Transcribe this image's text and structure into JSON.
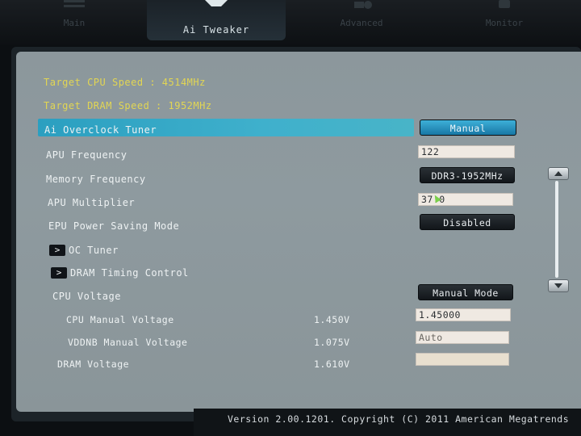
{
  "tabs": [
    {
      "label": "Main"
    },
    {
      "label": "Ai Tweaker"
    },
    {
      "label": "Advanced"
    },
    {
      "label": "Monitor"
    }
  ],
  "header": {
    "target_cpu": "Target CPU Speed : 4514MHz",
    "target_dram": "Target DRAM Speed : 1952MHz"
  },
  "settings": {
    "ai_overclock_tuner": {
      "label": "Ai Overclock Tuner",
      "value": "Manual"
    },
    "apu_frequency": {
      "label": "APU Frequency",
      "value": "122"
    },
    "memory_frequency": {
      "label": "Memory Frequency",
      "value": "DDR3-1952MHz"
    },
    "apu_multiplier": {
      "label": "APU Multiplier",
      "value": "37.0"
    },
    "epu_power_saving": {
      "label": "EPU Power Saving Mode",
      "value": "Disabled"
    },
    "oc_tuner": {
      "label": "OC Tuner"
    },
    "dram_timing": {
      "label": "DRAM Timing Control"
    },
    "cpu_voltage": {
      "label": "CPU Voltage",
      "value": "Manual Mode"
    },
    "cpu_manual_voltage": {
      "label": "CPU Manual Voltage",
      "current": "1.450V",
      "value": "1.45000"
    },
    "vddnb_manual_voltage": {
      "label": "VDDNB Manual Voltage",
      "current": "1.075V",
      "value": "Auto"
    },
    "dram_voltage": {
      "label": "DRAM Voltage",
      "current": "1.610V",
      "value": ""
    }
  },
  "submenu_arrow": ">",
  "footer": {
    "text": "Version 2.00.1201. Copyright (C) 2011 American Megatrends"
  },
  "colors": {
    "accent": "#2b9fc0",
    "header_text": "#e2d653",
    "panel": "#8c979c"
  }
}
